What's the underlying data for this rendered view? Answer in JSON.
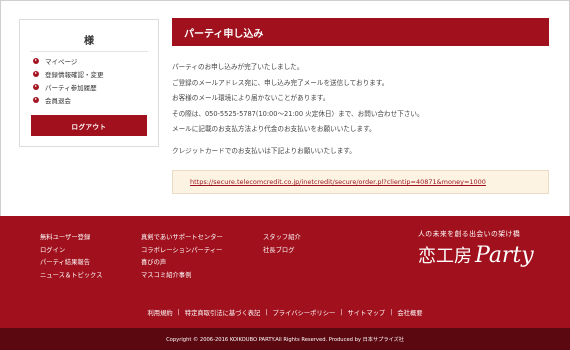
{
  "sidebar": {
    "title": "様",
    "items": [
      {
        "label": "マイページ"
      },
      {
        "label": "登録情報確認・変更"
      },
      {
        "label": "パーティ参加履歴"
      },
      {
        "label": "会員退会"
      }
    ],
    "logout_label": "ログアウト"
  },
  "main": {
    "heading": "パーティ申し込み",
    "paragraph1": [
      "パーティのお申し込みが完了いたしました。",
      "ご登録のメールアドレス宛に、申し込み完了メールを送信しております。",
      "お客様のメール環境により届かないことがあります。",
      "その際は、050-5525-5787(10:00〜21:00 火定休日）まで、お問い合わせ下さい。",
      "メールに記載のお支払方法より代金のお支払いをお願いいたします。"
    ],
    "paragraph2": "クレジットカードでのお支払いは下記よりお願いいたします。",
    "payment_link": "https://secure.telecomcredit.co.jp/inetcredit/secure/order.pl?clientip=40871&money=1000"
  },
  "footer": {
    "col1": [
      "無料ユーザー登録",
      "ログイン",
      "パーティ結果報告",
      "ニュース＆トピックス"
    ],
    "col2": [
      "真剣であいサポートセンター",
      "コラボレーションパーティー",
      "喜びの声",
      "マスコミ紹介事例"
    ],
    "col3": [
      "スタッフ紹介",
      "社長ブログ"
    ],
    "brand_tagline": "人の未来を創る出会いの架け橋",
    "brand_name_jp": "恋工房",
    "brand_name_en": "Party",
    "links": [
      "利用規約",
      "特定商取引法に基づく表記",
      "プライバシーポリシー",
      "サイトマップ",
      "会社概要"
    ],
    "copyright": "Copyright © 2006-2016 KOIKOUBO PARTY.All Rights Reserved. Produced by 日本サプライズ社"
  }
}
